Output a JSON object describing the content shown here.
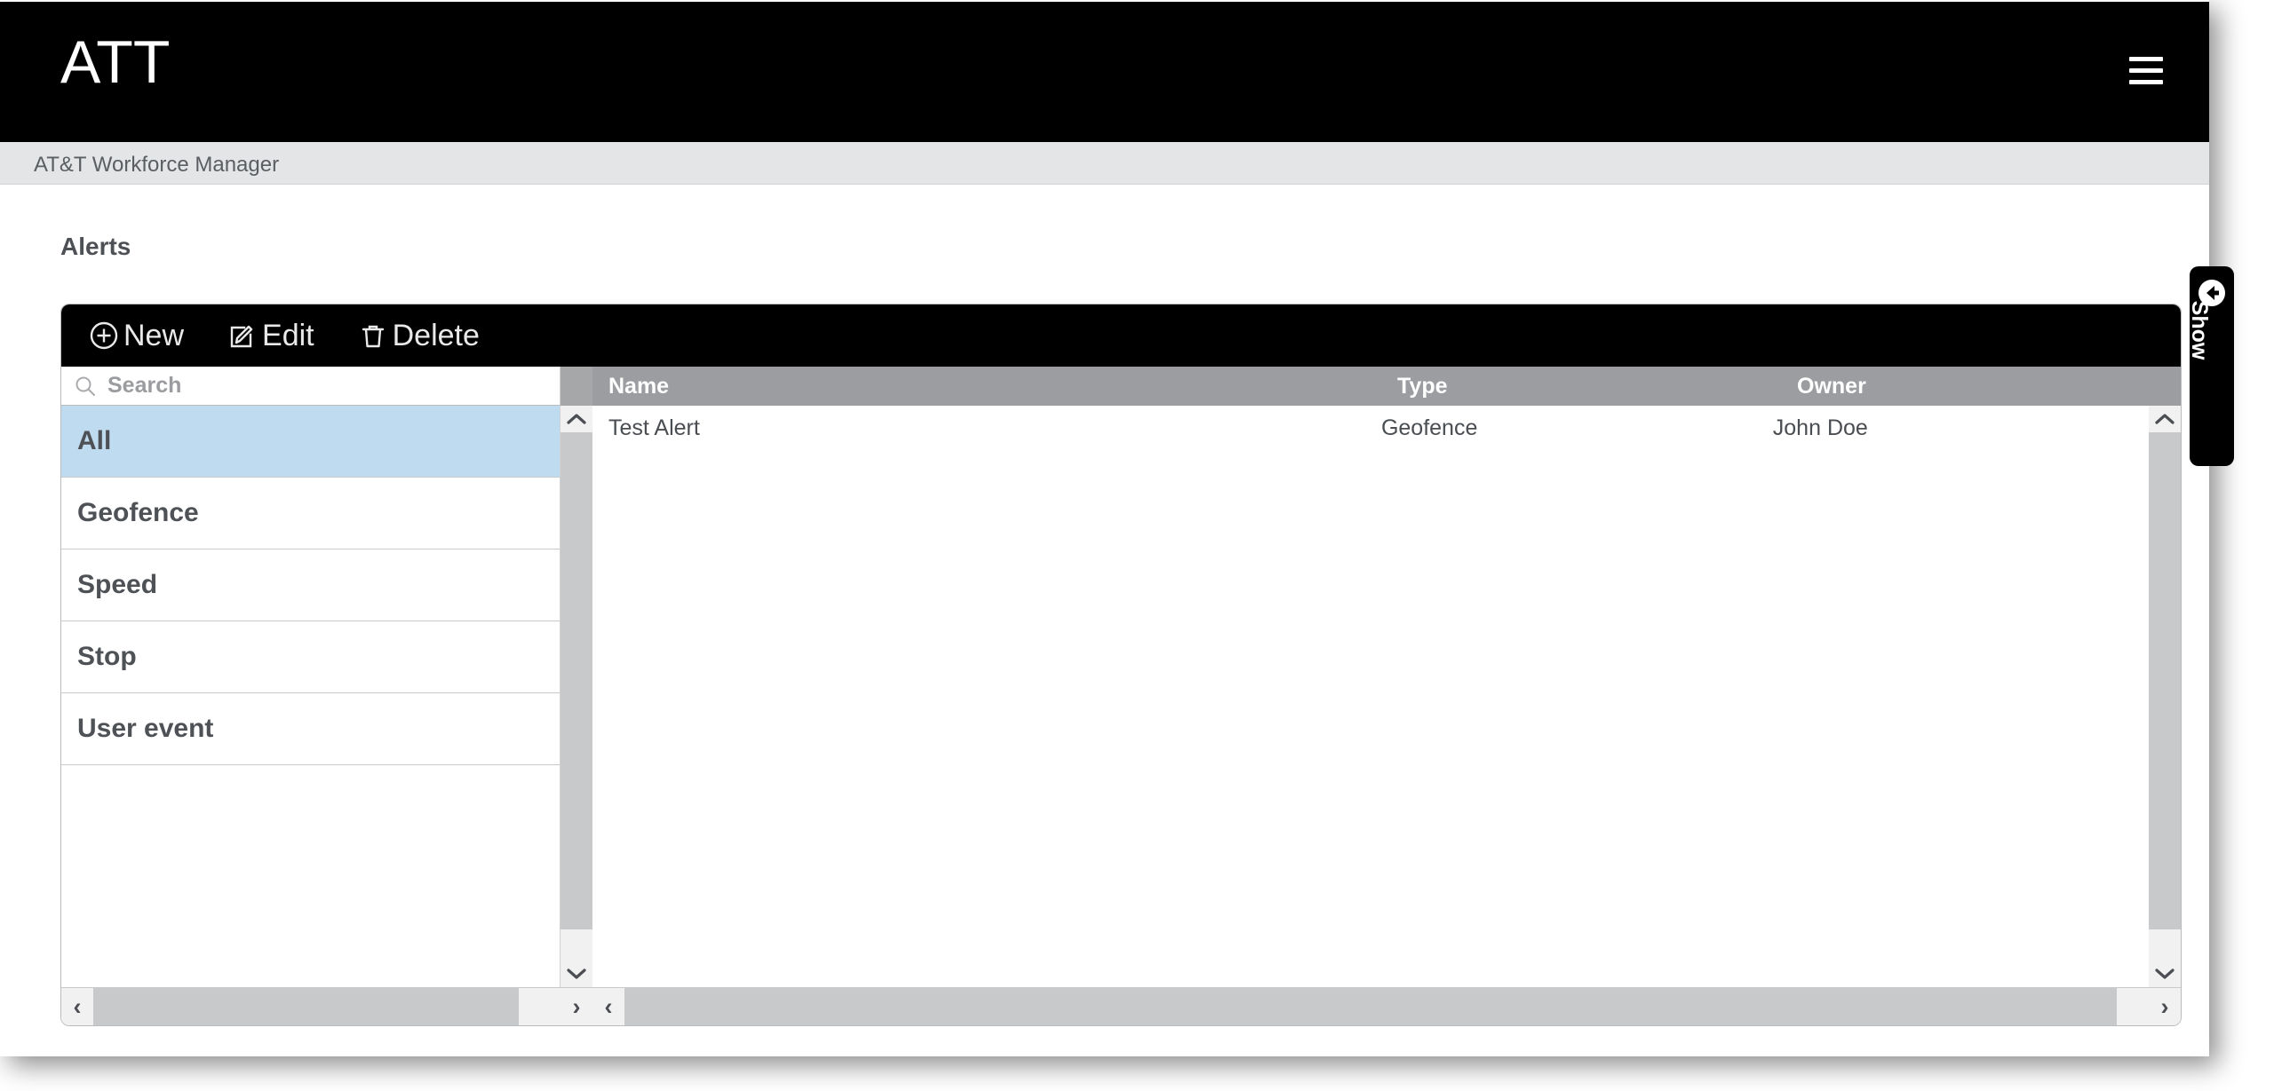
{
  "header": {
    "brand": "ATT",
    "menu_icon": "hamburger-icon",
    "subtitle": "AT&T Workforce Manager"
  },
  "page": {
    "title": "Alerts"
  },
  "toolbar": {
    "new_label": "New",
    "edit_label": "Edit",
    "delete_label": "Delete"
  },
  "search": {
    "placeholder": "Search",
    "value": ""
  },
  "categories": [
    {
      "label": "All",
      "selected": true
    },
    {
      "label": "Geofence",
      "selected": false
    },
    {
      "label": "Speed",
      "selected": false
    },
    {
      "label": "Stop",
      "selected": false
    },
    {
      "label": "User event",
      "selected": false
    }
  ],
  "table": {
    "columns": [
      "Name",
      "Type",
      "Owner"
    ],
    "rows": [
      {
        "name": "Test Alert",
        "type": "Geofence",
        "owner": "John Doe"
      }
    ]
  },
  "side_tab": {
    "label": "Show",
    "icon": "circle-arrow-left-icon"
  },
  "scroll_glyphs": {
    "left": "‹",
    "right": "›"
  },
  "colors": {
    "topbar": "#000000",
    "subbar": "#e3e5e7",
    "selected_row": "#bedbf0",
    "table_header": "#9b9da0",
    "scroll_thumb": "#c7c9cb"
  }
}
